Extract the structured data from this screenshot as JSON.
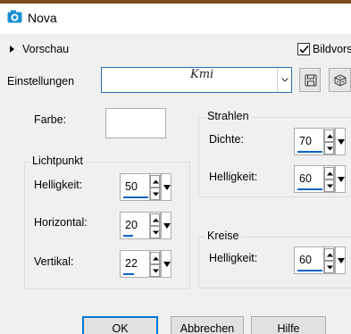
{
  "window": {
    "title": "Nova"
  },
  "preview": {
    "label": "Vorschau"
  },
  "bildvorschau": {
    "label": "Bildvors",
    "checked": true
  },
  "settings": {
    "label": "Einstellungen",
    "combo_value": "Kmi"
  },
  "farbe": {
    "label": "Farbe:"
  },
  "lichtpunkt": {
    "title": "Lichtpunkt",
    "helligkeit_label": "Helligkeit:",
    "helligkeit_value": "50",
    "horizontal_label": "Horizontal:",
    "horizontal_value": "20",
    "vertikal_label": "Vertikal:",
    "vertikal_value": "22"
  },
  "strahlen": {
    "title": "Strahlen",
    "dichte_label": "Dichte:",
    "dichte_value": "70",
    "helligkeit_label": "Helligkeit:",
    "helligkeit_value": "60"
  },
  "kreise": {
    "title": "Kreise",
    "helligkeit_label": "Helligkeit:",
    "helligkeit_value": "60"
  },
  "buttons": {
    "ok": "OK",
    "cancel": "Abbrechen",
    "help": "Hilfe"
  },
  "colors": {
    "accent": "#0078d7",
    "field_bar": "#0a64c8"
  }
}
